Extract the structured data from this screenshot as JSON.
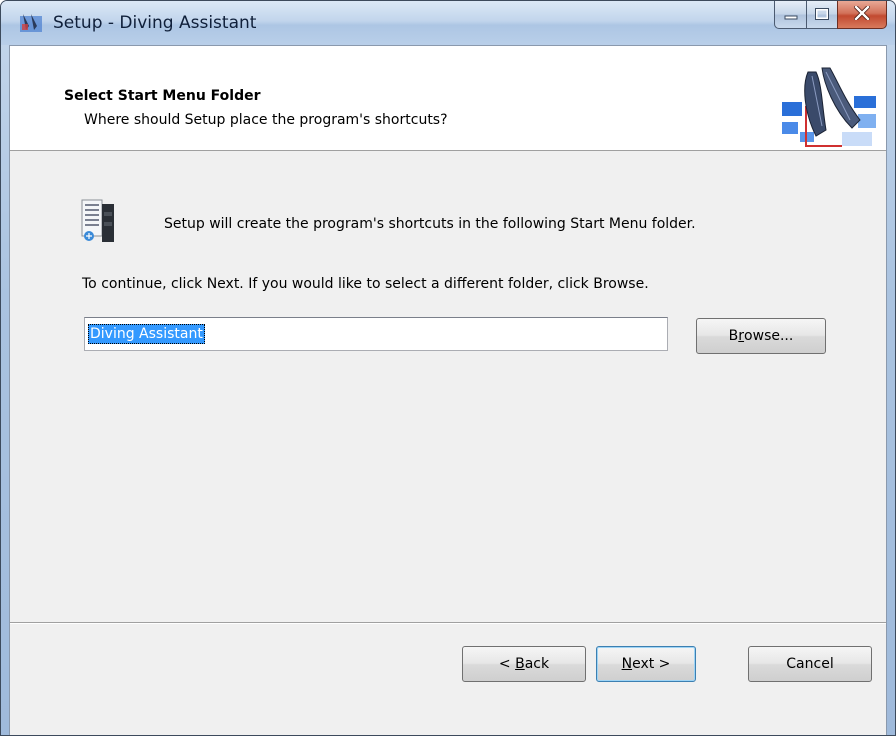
{
  "window": {
    "title": "Setup - Diving Assistant"
  },
  "caption_buttons": {
    "minimize": "minimize-icon",
    "maximize": "maximize-icon",
    "close": "close-icon"
  },
  "header": {
    "title": "Select Start Menu Folder",
    "subtitle": "Where should Setup place the program's shortcuts?"
  },
  "body": {
    "intro": "Setup will create the program's shortcuts in the following Start Menu folder.",
    "instruction": "To continue, click Next. If you would like to select a different folder, click Browse.",
    "folder_value": "Diving Assistant",
    "browse_label_pre": "B",
    "browse_label_accel": "r",
    "browse_label_post": "owse..."
  },
  "buttons": {
    "back_pre": "< ",
    "back_accel": "B",
    "back_post": "ack",
    "next_accel": "N",
    "next_post": "ext >",
    "cancel": "Cancel"
  },
  "colors": {
    "selection": "#3399ff",
    "client_bg": "#f0f0f0",
    "titlebar": "#c2d5ec",
    "close_button": "#c24a30"
  }
}
